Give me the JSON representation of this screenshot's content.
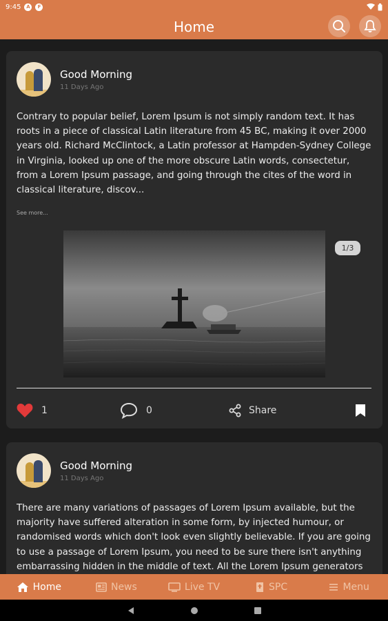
{
  "status_bar": {
    "time": "9:45",
    "icon1": "A",
    "icon2": "F"
  },
  "app_bar": {
    "title": "Home",
    "search_icon": "search-icon",
    "bell_icon": "bell-icon"
  },
  "posts": [
    {
      "author": "Good Morning",
      "time": "11 Days Ago",
      "text": "Contrary to popular belief, Lorem Ipsum is not simply random text. It has roots in a piece of classical Latin literature from 45 BC, making it over 2000 years old. Richard McClintock, a Latin professor at Hampden-Sydney College in Virginia, looked up one of the more obscure Latin words, consectetur, from a Lorem Ipsum passage, and going through the cites of the word in classical literature, discov...",
      "see_more": "See more...",
      "image_counter": "1/3",
      "likes": "1",
      "comments": "0",
      "share_label": "Share"
    },
    {
      "author": "Good Morning",
      "time": "11 Days Ago",
      "text": "There are many variations of passages of Lorem Ipsum available, but the majority have suffered alteration in some form, by injected humour, or randomised words which don't look even slightly believable. If you are going to use a passage of Lorem Ipsum, you need to be sure there isn't anything embarrassing hidden in the middle of text. All the Lorem Ipsum generators"
    }
  ],
  "bottom_nav": [
    {
      "label": "Home",
      "icon": "home-icon",
      "active": true
    },
    {
      "label": "News",
      "icon": "news-icon",
      "active": false
    },
    {
      "label": "Live TV",
      "icon": "tv-icon",
      "active": false
    },
    {
      "label": "SPC",
      "icon": "book-icon",
      "active": false
    },
    {
      "label": "Menu",
      "icon": "menu-icon",
      "active": false
    }
  ],
  "colors": {
    "accent": "#d97b4a",
    "card": "#2b2b2b",
    "background": "#1c1c1c",
    "like": "#e23a3a"
  }
}
